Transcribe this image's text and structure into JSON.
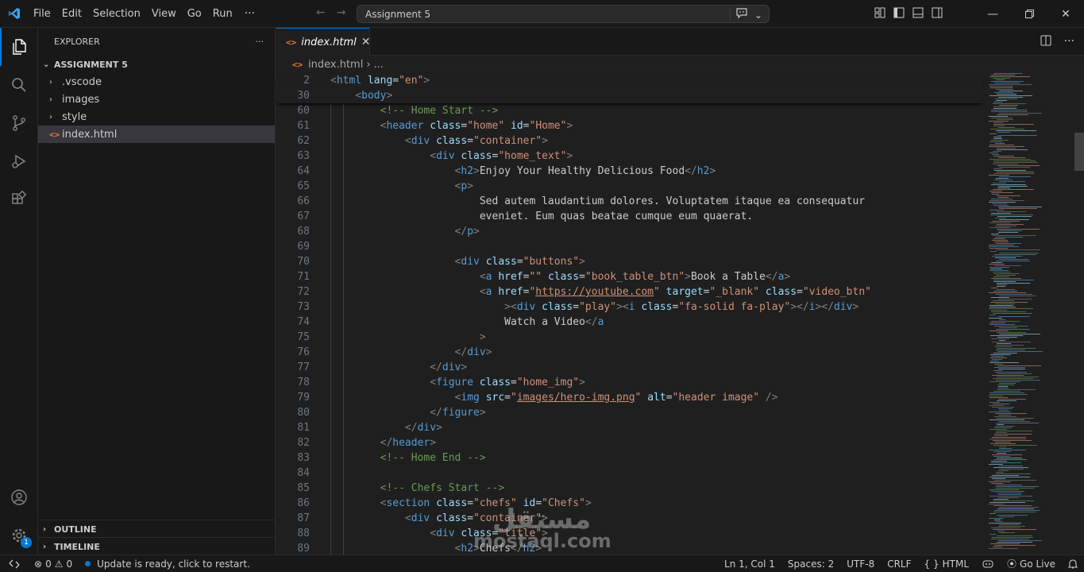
{
  "menu": [
    "File",
    "Edit",
    "Selection",
    "View",
    "Go",
    "Run"
  ],
  "menu_more": "···",
  "command_center": "Assignment 5",
  "explorer": {
    "header": "EXPLORER",
    "more": "···",
    "workspace": "ASSIGNMENT 5",
    "items": [
      {
        "label": ".vscode",
        "type": "folder"
      },
      {
        "label": "images",
        "type": "folder"
      },
      {
        "label": "style",
        "type": "folder"
      },
      {
        "label": "index.html",
        "type": "file"
      }
    ],
    "outline": "OUTLINE",
    "timeline": "TIMELINE"
  },
  "tab": {
    "label": "index.html",
    "icon": "<>",
    "close": "✕"
  },
  "breadcrumb": {
    "file": "index.html",
    "rest": "..."
  },
  "sticky_lines": [
    {
      "n": "2",
      "src": "<html lang=\"en\">"
    },
    {
      "n": "30",
      "src": "<body>"
    }
  ],
  "code_lines": [
    {
      "n": "60",
      "src": "<!-- Home Start -->"
    },
    {
      "n": "61",
      "src": "<header class=\"home\" id=\"Home\">"
    },
    {
      "n": "62",
      "src": "<div class=\"container\">"
    },
    {
      "n": "63",
      "src": "<div class=\"home_text\">"
    },
    {
      "n": "64",
      "src": "<h2>Enjoy Your Healthy Delicious Food</h2>"
    },
    {
      "n": "65",
      "src": "<p>"
    },
    {
      "n": "66",
      "src": "Sed autem laudantium dolores. Voluptatem itaque ea consequatur"
    },
    {
      "n": "67",
      "src": "eveniet. Eum quas beatae cumque eum quaerat."
    },
    {
      "n": "68",
      "src": "</p>"
    },
    {
      "n": "69",
      "src": ""
    },
    {
      "n": "70",
      "src": "<div class=\"buttons\">"
    },
    {
      "n": "71",
      "src": "<a href=\"\" class=\"book_table_btn\">Book a Table</a>"
    },
    {
      "n": "72",
      "src": "<a href=\"https://youtube.com\" target=\"_blank\" class=\"video_btn\""
    },
    {
      "n": "73",
      "src": "><div class=\"play\"><i class=\"fa-solid fa-play\"></i></div>"
    },
    {
      "n": "74",
      "src": "Watch a Video</a"
    },
    {
      "n": "75",
      "src": ">"
    },
    {
      "n": "76",
      "src": "</div>"
    },
    {
      "n": "77",
      "src": "</div>"
    },
    {
      "n": "78",
      "src": "<figure class=\"home_img\">"
    },
    {
      "n": "79",
      "src": "<img src=\"images/hero-img.png\" alt=\"header image\" />"
    },
    {
      "n": "80",
      "src": "</figure>"
    },
    {
      "n": "81",
      "src": "</div>"
    },
    {
      "n": "82",
      "src": "</header>"
    },
    {
      "n": "83",
      "src": "<!-- Home End -->"
    },
    {
      "n": "84",
      "src": ""
    },
    {
      "n": "85",
      "src": "<!-- Chefs Start -->"
    },
    {
      "n": "86",
      "src": "<section class=\"chefs\" id=\"Chefs\">"
    },
    {
      "n": "87",
      "src": "<div class=\"container\">"
    },
    {
      "n": "88",
      "src": "<div class=\"title\">"
    },
    {
      "n": "89",
      "src": "<h2>Chefs</h2>"
    }
  ],
  "status": {
    "errors": "0",
    "warnings": "0",
    "message": "Update is ready, click to restart.",
    "position": "Ln 1, Col 1",
    "spaces": "Spaces: 2",
    "encoding": "UTF-8",
    "eol": "CRLF",
    "language_braces": "{ }",
    "language": "HTML",
    "go_live": "Go Live"
  },
  "accounts_badge": "1",
  "watermark": {
    "arabic": "مستقل",
    "latin": "mostaql.com"
  },
  "colors": {
    "accent": "#0078d4",
    "tag": "#569cd6",
    "attr": "#9cdcfe",
    "string": "#ce9178",
    "comment": "#6a9955",
    "html_icon": "#e37933"
  }
}
